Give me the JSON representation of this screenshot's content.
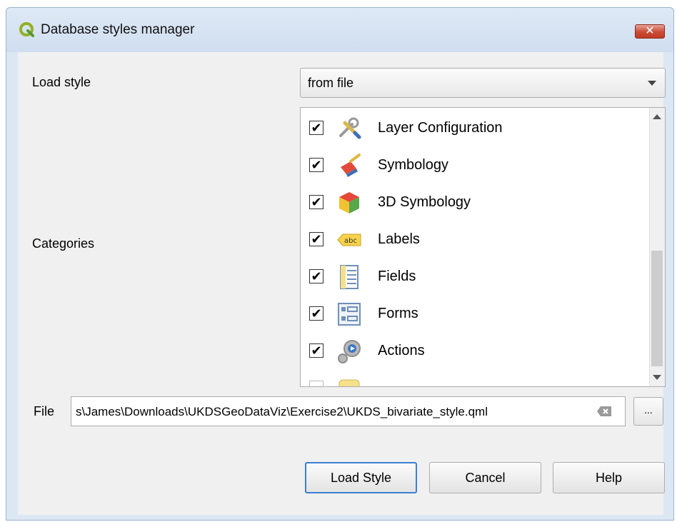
{
  "window": {
    "title": "Database styles manager"
  },
  "load_style": {
    "label": "Load style",
    "value": "from file"
  },
  "categories": {
    "label": "Categories",
    "items": [
      {
        "label": "Layer Configuration",
        "checked": true,
        "icon": "layer-configuration-icon"
      },
      {
        "label": "Symbology",
        "checked": true,
        "icon": "symbology-icon"
      },
      {
        "label": "3D Symbology",
        "checked": true,
        "icon": "3d-symbology-icon"
      },
      {
        "label": "Labels",
        "checked": true,
        "icon": "labels-icon"
      },
      {
        "label": "Fields",
        "checked": true,
        "icon": "fields-icon"
      },
      {
        "label": "Forms",
        "checked": true,
        "icon": "forms-icon"
      },
      {
        "label": "Actions",
        "checked": true,
        "icon": "actions-icon"
      }
    ]
  },
  "file": {
    "label": "File",
    "value": "s\\James\\Downloads\\UKDSGeoDataViz\\Exercise2\\UKDS_bivariate_style.qml",
    "browse_label": "..."
  },
  "buttons": {
    "load": "Load Style",
    "cancel": "Cancel",
    "help": "Help"
  },
  "icons": {
    "close": "close-icon",
    "app": "qgis-icon",
    "clear": "clear-icon"
  },
  "colors": {
    "close_button": "#c94a35",
    "default_button_border": "#3c7fd0"
  }
}
